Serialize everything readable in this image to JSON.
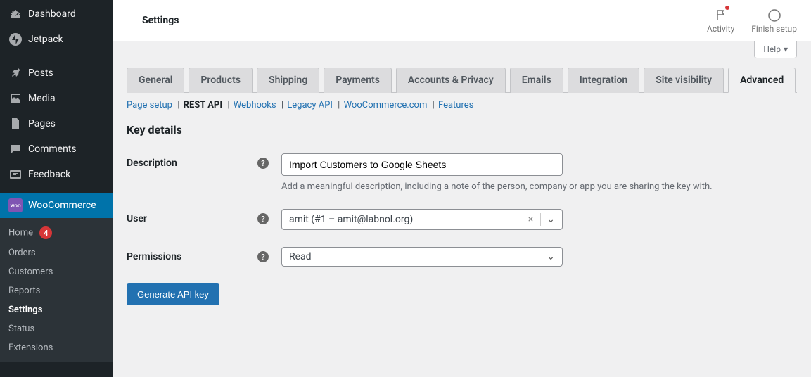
{
  "sidebar": {
    "items": [
      {
        "label": "Dashboard"
      },
      {
        "label": "Jetpack"
      },
      {
        "label": "Posts"
      },
      {
        "label": "Media"
      },
      {
        "label": "Pages"
      },
      {
        "label": "Comments"
      },
      {
        "label": "Feedback"
      },
      {
        "label": "WooCommerce"
      }
    ],
    "submenu": {
      "home": {
        "label": "Home",
        "badge": "4"
      },
      "orders": "Orders",
      "customers": "Customers",
      "reports": "Reports",
      "settings": "Settings",
      "status": "Status",
      "extensions": "Extensions"
    }
  },
  "topbar": {
    "title": "Settings",
    "activity": "Activity",
    "finish": "Finish setup",
    "help": "Help"
  },
  "tabs": {
    "general": "General",
    "products": "Products",
    "shipping": "Shipping",
    "payments": "Payments",
    "accounts": "Accounts & Privacy",
    "emails": "Emails",
    "integration": "Integration",
    "visibility": "Site visibility",
    "advanced": "Advanced"
  },
  "subtabs": {
    "page_setup": "Page setup",
    "rest_api": "REST API",
    "webhooks": "Webhooks",
    "legacy": "Legacy API",
    "woo": "WooCommerce.com",
    "features": "Features"
  },
  "section": {
    "title": "Key details"
  },
  "form": {
    "description": {
      "label": "Description",
      "value": "Import Customers to Google Sheets",
      "help": "Add a meaningful description, including a note of the person, company or app you are sharing the key with."
    },
    "user": {
      "label": "User",
      "value": "amit (#1 – amit@labnol.org)"
    },
    "permissions": {
      "label": "Permissions",
      "value": "Read"
    }
  },
  "button": {
    "generate": "Generate API key"
  }
}
